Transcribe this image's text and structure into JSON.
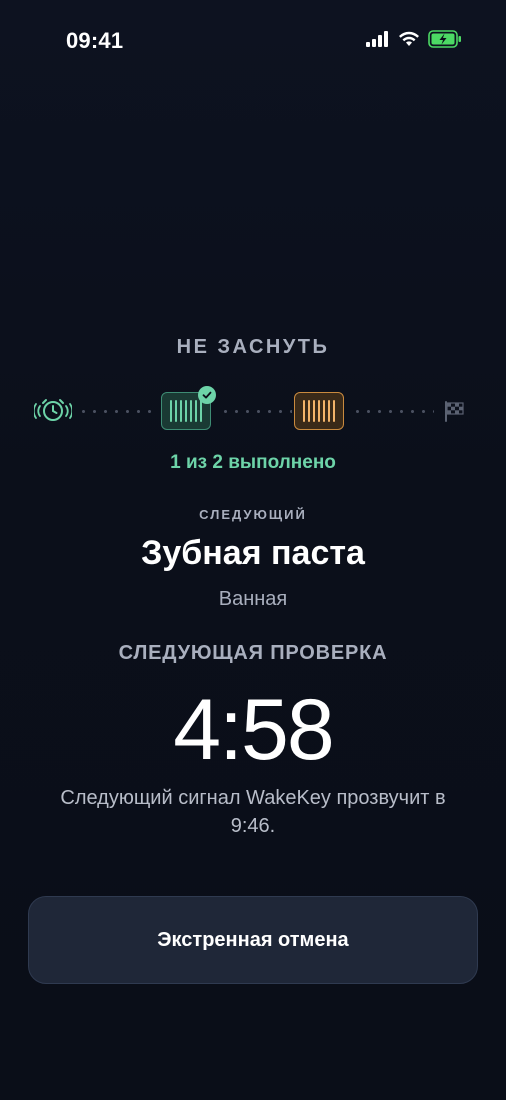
{
  "status_bar": {
    "time": "09:41",
    "icons": [
      "signal-icon",
      "wifi-icon",
      "battery-charging-icon"
    ]
  },
  "mode": {
    "title": "НЕ ЗАСНУТЬ"
  },
  "progress": {
    "start_icon": "alarm-clock-icon",
    "end_icon": "finish-flag-icon",
    "steps": [
      {
        "icon": "barcode-icon",
        "state": "done"
      },
      {
        "icon": "barcode-icon",
        "state": "current"
      }
    ],
    "completed": 1,
    "total": 2,
    "text": "1 из 2 выполнено"
  },
  "next": {
    "label": "СЛЕДУЮЩИЙ",
    "task": "Зубная паста",
    "location": "Ванная"
  },
  "check": {
    "label": "СЛЕДУЮЩАЯ ПРОВЕРКА",
    "countdown": "4:58",
    "note": "Следующий сигнал WakeKey прозвучит в 9:46."
  },
  "actions": {
    "cancel_label": "Экстренная отмена"
  },
  "colors": {
    "background": "#0b0f1a",
    "accent_green": "#6dd3a8",
    "accent_orange": "#f3b46a",
    "muted_text": "#a9afbe",
    "button_bg": "#1f2738"
  }
}
